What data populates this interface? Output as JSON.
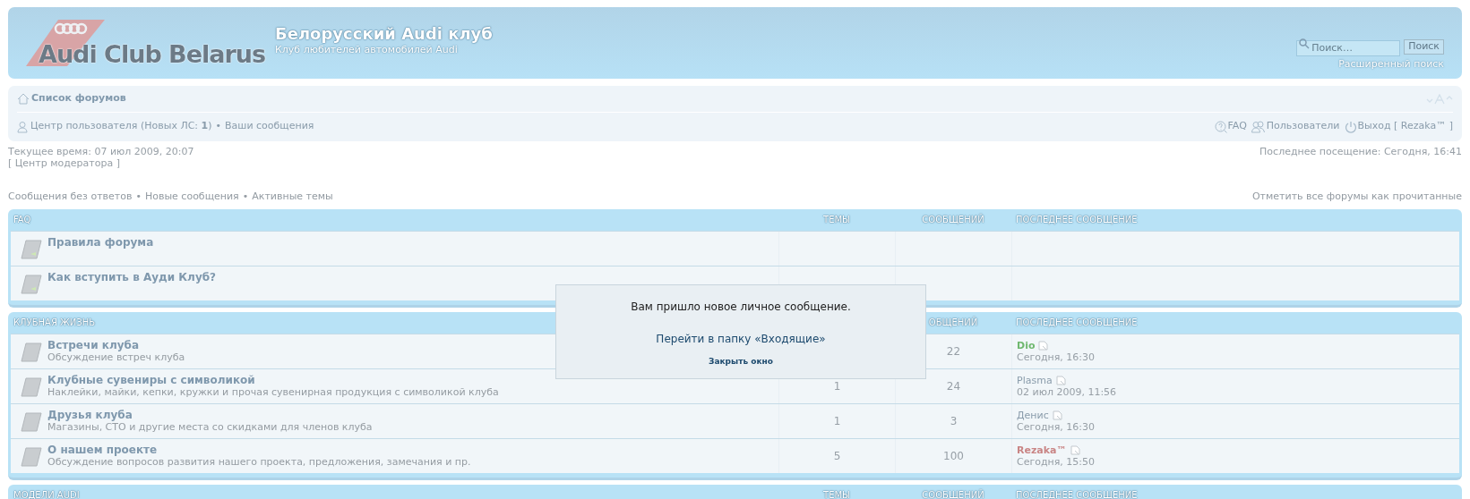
{
  "header": {
    "logo_text": "Audi Club Belarus",
    "site_title": "Белорусский Audi клуб",
    "site_description": "Клуб любителей автомобилей Audi",
    "search": {
      "placeholder": "Поиск…",
      "button": "Поиск",
      "advanced_link": "Расширенный поиск"
    }
  },
  "navbar": {
    "breadcrumb": "Список форумов",
    "user_links": [
      {
        "kind": "link",
        "text": "Центр пользователя (Новых ЛС: **1**)"
      },
      {
        "kind": "separator",
        "text": "•"
      },
      {
        "kind": "link",
        "text": "Ваши сообщения"
      }
    ],
    "right_links": [
      {
        "kind": "link",
        "text": "FAQ"
      },
      {
        "kind": "link",
        "text": "Пользователи"
      },
      {
        "kind": "link",
        "text": "Выход [ Rezaka™ ]"
      }
    ]
  },
  "info": {
    "current_time": "Текущее время: 07 июл 2009, 20:07",
    "moderator_link": "[ Центр модератора ]",
    "last_visit": "Последнее посещение: Сегодня, 16:41"
  },
  "search_links": [
    {
      "kind": "link",
      "text": "Сообщения без ответов"
    },
    {
      "kind": "separator",
      "text": "•"
    },
    {
      "kind": "link",
      "text": "Новые сообщения"
    },
    {
      "kind": "separator",
      "text": "•"
    },
    {
      "kind": "link",
      "text": "Активные темы"
    }
  ],
  "mark_read": "Отметить все форумы как прочитанные",
  "sections": [
    {
      "title": "FAQ",
      "columns": {
        "topics": "ТЕМЫ",
        "posts": "СООБЩЕНИЙ",
        "last_post": "ПОСЛЕДНЕЕ СООБЩЕНИЕ"
      },
      "forums": [
        {
          "kind": "link",
          "title": "Правила форума"
        },
        {
          "kind": "link",
          "title": "Как вступить в Ауди Клуб?"
        }
      ]
    },
    {
      "title": "КЛУБНАЯ ЖИЗНЬ",
      "columns": {
        "posts": "ОБЩЕНИЙ",
        "last_post": "ПОСЛЕДНЕЕ СООБЩЕНИЕ"
      },
      "forums": [
        {
          "kind": "forum",
          "title": "Встречи клуба",
          "description": "Обсуждение встреч клуба",
          "posts": "22",
          "last_author": "Dio",
          "color": "#6fb86f",
          "last_time": "Сегодня, 16:30"
        },
        {
          "kind": "forum",
          "title": "Клубные сувениры с символикой",
          "description": "Наклейки, майки, кепки, кружки и прочая сувенирная продукция с символикой клуба",
          "topics": "1",
          "posts": "24",
          "last_author": "Plasma",
          "color": "#8a9cab",
          "last_time": "02 июл 2009, 11:56"
        },
        {
          "kind": "forum",
          "title": "Друзья клуба",
          "description": "Магазины, СТО и другие места со скидками для членов клуба",
          "topics": "1",
          "posts": "3",
          "last_author": "Денис",
          "color": "#8a9cab",
          "last_time": "Сегодня, 16:30"
        },
        {
          "kind": "forum",
          "title": "О нашем проекте",
          "description": "Обсуждение вопросов развития нашего проекта, предложения, замечания и пр.",
          "topics": "5",
          "posts": "100",
          "last_author": "Rezaka™",
          "color": "#c98585",
          "last_time": "Сегодня, 15:50"
        }
      ]
    },
    {
      "title": "МОДЕЛИ AUDI",
      "columns": {
        "topics": "ТЕМЫ",
        "posts": "СООБЩЕНИЙ",
        "last_post": "ПОСЛЕДНЕЕ СООБЩЕНИЕ"
      }
    }
  ],
  "popup": {
    "message": "Вам пришло новое личное сообщение.",
    "inbox_link": "Перейти в папку «Входящие»",
    "close_link": "Закрыть окно"
  }
}
